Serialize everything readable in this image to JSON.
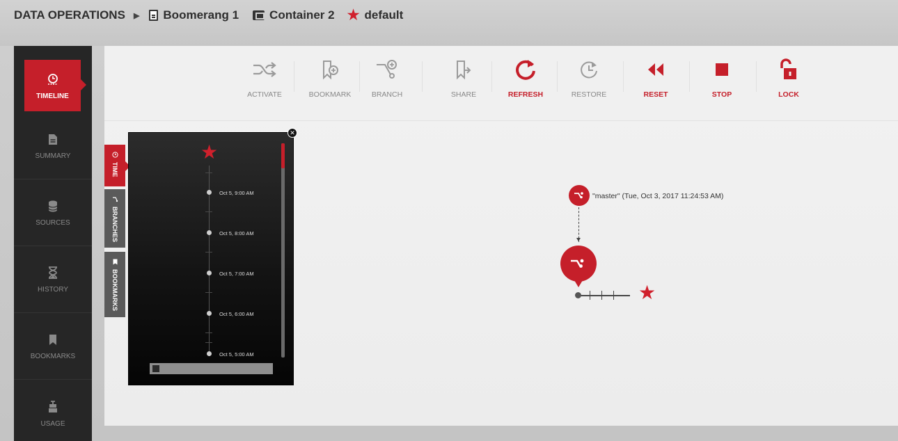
{
  "breadcrumb": {
    "root": "DATA OPERATIONS",
    "item1": "Boomerang 1",
    "item2": "Container 2",
    "item3": "default"
  },
  "sidebar": {
    "items": [
      {
        "label": "TIMELINE",
        "icon": "timeline-clock-icon",
        "active": true
      },
      {
        "label": "SUMMARY",
        "icon": "document-icon"
      },
      {
        "label": "SOURCES",
        "icon": "database-icon"
      },
      {
        "label": "HISTORY",
        "icon": "hourglass-icon"
      },
      {
        "label": "BOOKMARKS",
        "icon": "bookmark-icon"
      },
      {
        "label": "USAGE",
        "icon": "weight-icon"
      }
    ]
  },
  "toolbar": {
    "activate": "ACTIVATE",
    "bookmark": "BOOKMARK",
    "branch": "BRANCH",
    "share": "SHARE",
    "refresh": "REFRESH",
    "restore": "RESTORE",
    "reset": "RESET",
    "stop": "STOP",
    "lock": "LOCK"
  },
  "timeline_panel": {
    "tabs": {
      "time": "TIME",
      "branches": "BRANCHES",
      "bookmarks": "BOOKMARKS"
    },
    "entries": [
      "Oct 5, 9:00 AM",
      "Oct 5, 8:00 AM",
      "Oct 5, 7:00 AM",
      "Oct 5, 6:00 AM",
      "Oct 5, 5:00 AM"
    ]
  },
  "graph": {
    "master_label": "\"master\" (Tue, Oct 3, 2017 11:24:53 AM)"
  },
  "colors": {
    "accent": "#c51f2a",
    "nav_bg": "#262626"
  }
}
